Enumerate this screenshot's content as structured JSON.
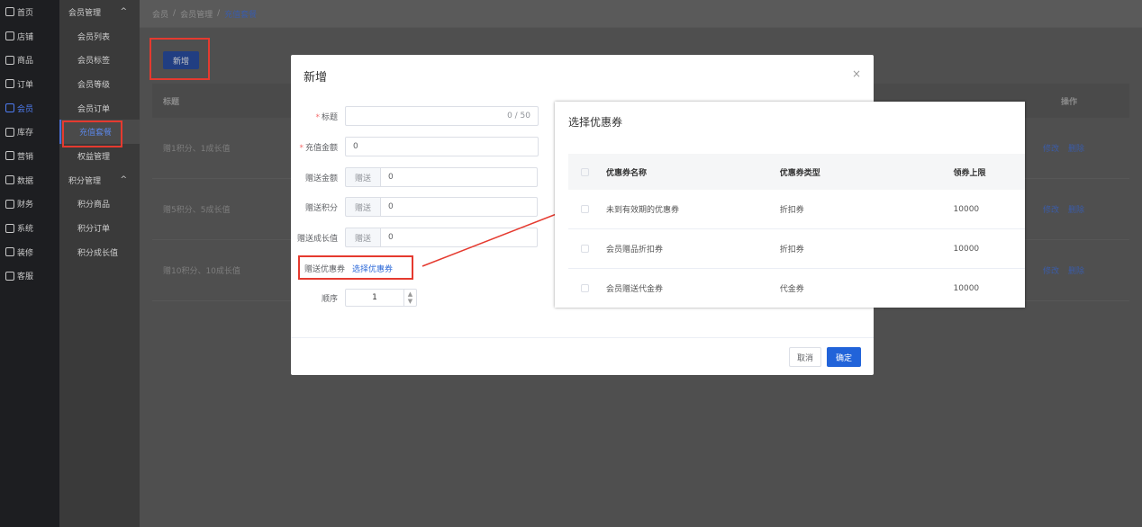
{
  "nav_primary": [
    {
      "label": "首页",
      "icon": "home-icon"
    },
    {
      "label": "店铺",
      "icon": "shop-icon"
    },
    {
      "label": "商品",
      "icon": "goods-icon"
    },
    {
      "label": "订单",
      "icon": "order-icon"
    },
    {
      "label": "会员",
      "icon": "member-icon",
      "active": true
    },
    {
      "label": "库存",
      "icon": "stock-icon"
    },
    {
      "label": "营销",
      "icon": "marketing-icon"
    },
    {
      "label": "数据",
      "icon": "data-icon"
    },
    {
      "label": "财务",
      "icon": "finance-icon"
    },
    {
      "label": "系统",
      "icon": "system-icon"
    },
    {
      "label": "装修",
      "icon": "decorate-icon"
    },
    {
      "label": "客服",
      "icon": "service-icon"
    }
  ],
  "nav_secondary": {
    "group1": "会员管理",
    "group1_chevron": "^",
    "items1": [
      "会员列表",
      "会员标签",
      "会员等级",
      "会员订单",
      "充值套餐",
      "权益管理"
    ],
    "group2": "积分管理",
    "group2_chevron": "^",
    "items2": [
      "积分商品",
      "积分订单",
      "积分成长值"
    ]
  },
  "breadcrumb": {
    "part1": "会员",
    "part2": "会员管理",
    "current": "充值套餐",
    "sep": "/"
  },
  "toolbar": {
    "new_label": "新增"
  },
  "table": {
    "header_title": "标题",
    "header_ops": "操作",
    "rows": [
      {
        "title": "赠1积分、1成长值"
      },
      {
        "title": "赠5积分、5成长值"
      },
      {
        "title": "赠10积分、10成长值"
      }
    ],
    "edit_label": "修改",
    "delete_label": "删除"
  },
  "dialog": {
    "title": "新增",
    "close": "×",
    "title_label": "标题",
    "title_counter": "0 / 50",
    "amount_label": "充值金额",
    "amount_value": "0",
    "gift_amount_label": "赠送金额",
    "gift_prepend": "赠送",
    "gift_amount_value": "0",
    "gift_points_label": "赠送积分",
    "gift_points_value": "0",
    "gift_growth_label": "赠送成长值",
    "gift_growth_value": "0",
    "coupon_label": "赠送优惠券",
    "coupon_link": "选择优惠券",
    "order_label": "顺序",
    "order_value": "1",
    "cancel": "取消",
    "confirm": "确定"
  },
  "coupon_dialog": {
    "title": "选择优惠券",
    "headers": [
      "优惠券名称",
      "优惠券类型",
      "领券上限"
    ],
    "rows": [
      [
        "未到有效期的优惠券",
        "折扣券",
        "10000"
      ],
      [
        "会员赠品折扣券",
        "折扣券",
        "10000"
      ],
      [
        "会员赠送代金券",
        "代金券",
        "10000"
      ]
    ]
  },
  "colors": {
    "accent": "#2163d9",
    "highlight": "#e53a2f"
  }
}
